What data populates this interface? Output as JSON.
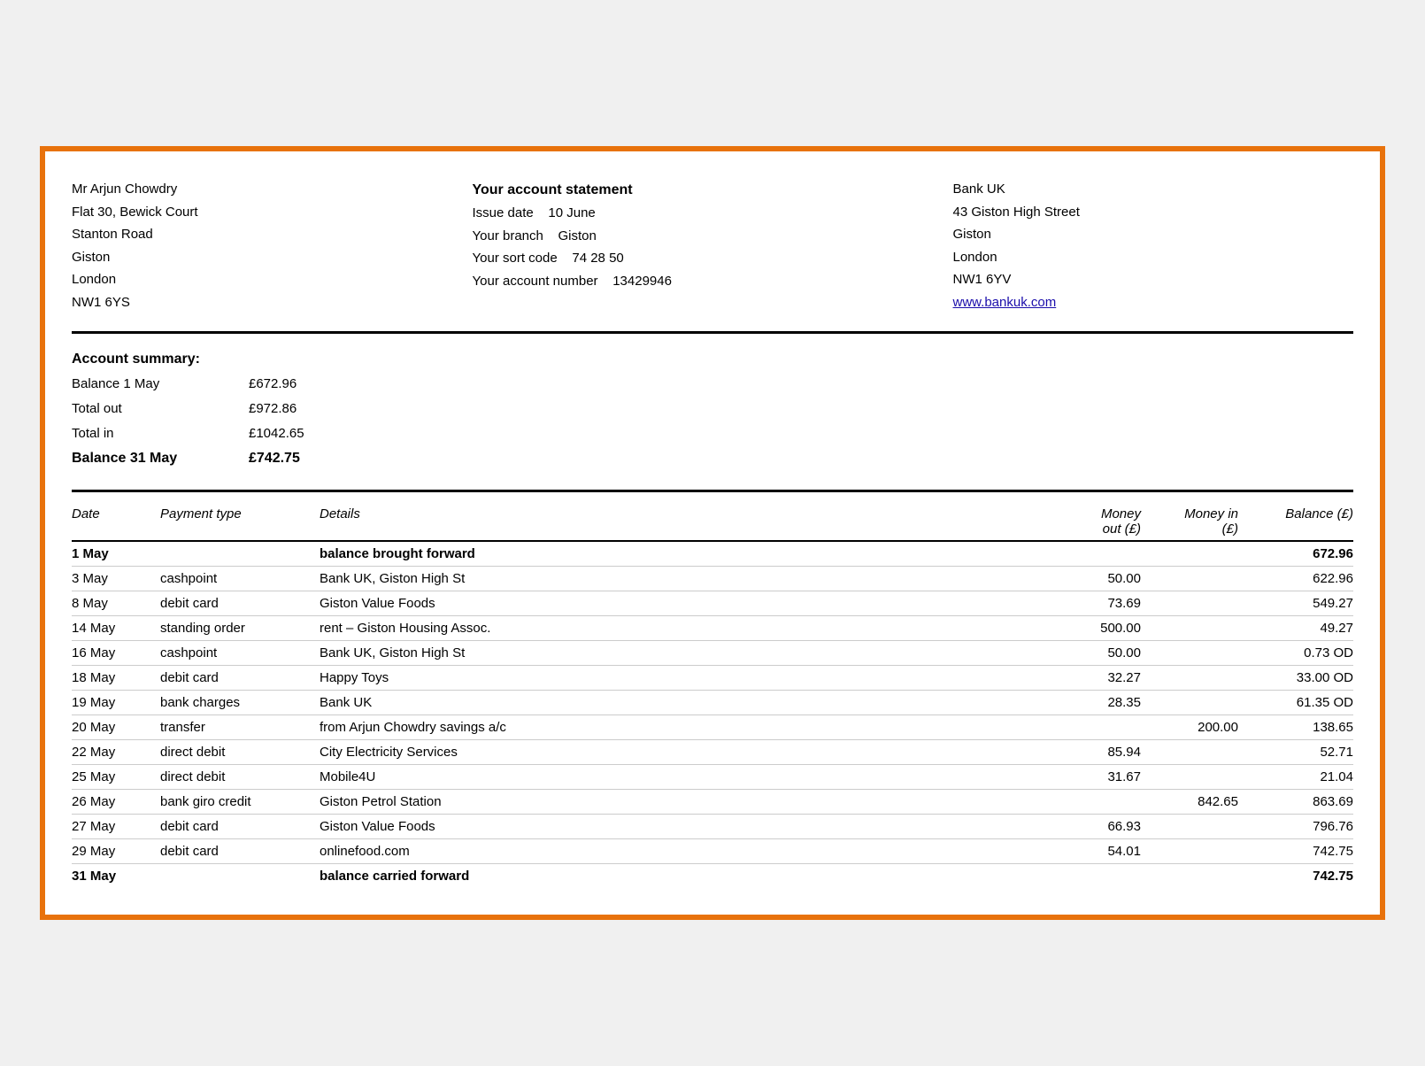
{
  "header": {
    "customer": {
      "name": "Mr Arjun Chowdry",
      "address1": "Flat 30, Bewick Court",
      "address2": "Stanton Road",
      "address3": "Giston",
      "address4": "London",
      "address5": "NW1 6YS"
    },
    "statement": {
      "title": "Your account statement",
      "issue_label": "Issue date",
      "issue_value": "10 June",
      "branch_label": "Your branch",
      "branch_value": "Giston",
      "sort_label": "Your sort code",
      "sort_value": "74 28 50",
      "account_label": "Your account number",
      "account_value": "13429946"
    },
    "bank": {
      "name": "Bank UK",
      "address1": "43 Giston High Street",
      "address2": "Giston",
      "address3": "London",
      "address4": "NW1 6YV",
      "website": "www.bankuk.com"
    }
  },
  "summary": {
    "title": "Account summary:",
    "rows": [
      {
        "label": "Balance 1 May",
        "value": "£672.96",
        "bold": false
      },
      {
        "label": "Total out",
        "value": "£972.86",
        "bold": false
      },
      {
        "label": "Total in",
        "value": "£1042.65",
        "bold": false
      },
      {
        "label": "Balance 31 May",
        "value": "£742.75",
        "bold": true
      }
    ]
  },
  "table": {
    "columns": {
      "date": "Date",
      "payment": "Payment type",
      "details": "Details",
      "money_out": [
        "Money",
        "out (£)"
      ],
      "money_in": [
        "Money in",
        "(£)"
      ],
      "balance": "Balance (£)"
    },
    "rows": [
      {
        "date": "1 May",
        "payment": "",
        "details": "balance brought forward",
        "money_out": "",
        "money_in": "",
        "balance": "672.96",
        "bold": true
      },
      {
        "date": "3 May",
        "payment": "cashpoint",
        "details": "Bank UK, Giston High St",
        "money_out": "50.00",
        "money_in": "",
        "balance": "622.96",
        "bold": false
      },
      {
        "date": "8 May",
        "payment": "debit card",
        "details": "Giston Value Foods",
        "money_out": "73.69",
        "money_in": "",
        "balance": "549.27",
        "bold": false
      },
      {
        "date": "14 May",
        "payment": "standing order",
        "details": "rent – Giston Housing Assoc.",
        "money_out": "500.00",
        "money_in": "",
        "balance": "49.27",
        "bold": false
      },
      {
        "date": "16 May",
        "payment": "cashpoint",
        "details": "Bank UK, Giston High St",
        "money_out": "50.00",
        "money_in": "",
        "balance": "0.73 OD",
        "bold": false
      },
      {
        "date": "18 May",
        "payment": "debit card",
        "details": "Happy Toys",
        "money_out": "32.27",
        "money_in": "",
        "balance": "33.00 OD",
        "bold": false
      },
      {
        "date": "19 May",
        "payment": "bank charges",
        "details": "Bank UK",
        "money_out": "28.35",
        "money_in": "",
        "balance": "61.35 OD",
        "bold": false
      },
      {
        "date": "20 May",
        "payment": "transfer",
        "details": "from Arjun Chowdry savings a/c",
        "money_out": "",
        "money_in": "200.00",
        "balance": "138.65",
        "bold": false
      },
      {
        "date": "22 May",
        "payment": "direct debit",
        "details": "City Electricity Services",
        "money_out": "85.94",
        "money_in": "",
        "balance": "52.71",
        "bold": false
      },
      {
        "date": "25 May",
        "payment": "direct debit",
        "details": "Mobile4U",
        "money_out": "31.67",
        "money_in": "",
        "balance": "21.04",
        "bold": false
      },
      {
        "date": "26 May",
        "payment": "bank giro credit",
        "details": "Giston Petrol Station",
        "money_out": "",
        "money_in": "842.65",
        "balance": "863.69",
        "bold": false
      },
      {
        "date": "27 May",
        "payment": "debit card",
        "details": "Giston Value Foods",
        "money_out": "66.93",
        "money_in": "",
        "balance": "796.76",
        "bold": false
      },
      {
        "date": "29 May",
        "payment": "debit card",
        "details": "onlinefood.com",
        "money_out": "54.01",
        "money_in": "",
        "balance": "742.75",
        "bold": false
      },
      {
        "date": "31 May",
        "payment": "",
        "details": "balance carried forward",
        "money_out": "",
        "money_in": "",
        "balance": "742.75",
        "bold": true
      }
    ]
  }
}
